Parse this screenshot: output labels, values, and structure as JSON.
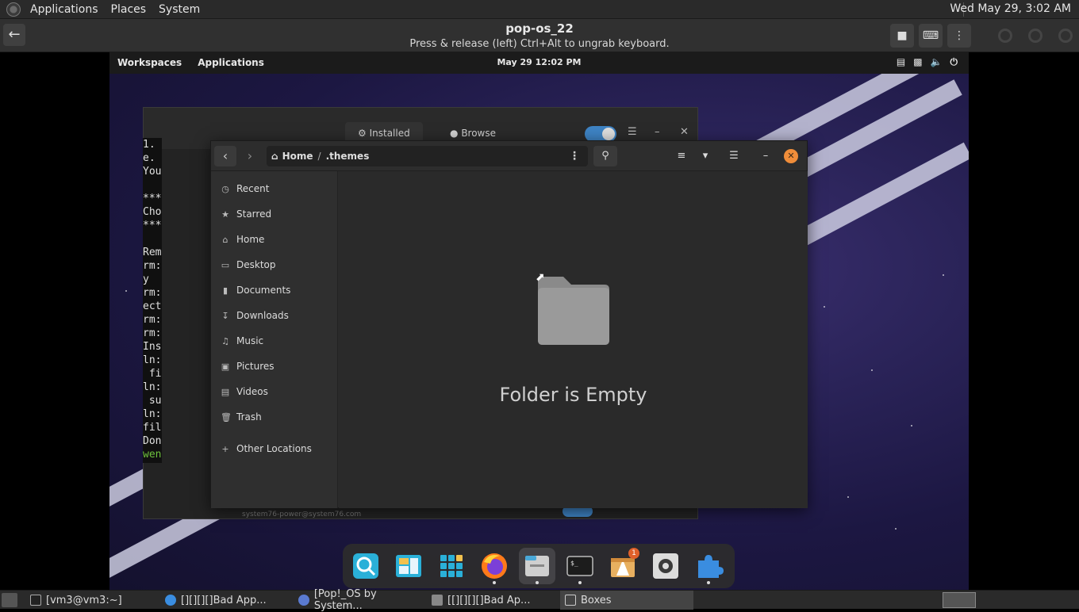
{
  "host_panel": {
    "menu": [
      "Applications",
      "Places",
      "System"
    ],
    "clock": "Wed May 29,  3:02 AM"
  },
  "boxes_header": {
    "title": "pop-os_22",
    "subtitle": "Press & release (left) Ctrl+Alt to ungrab keyboard."
  },
  "guest_bar": {
    "workspaces": "Workspaces",
    "applications": "Applications",
    "clock": "May 29  12:02 PM"
  },
  "shop_window": {
    "tab_installed": "Installed",
    "tab_browse": "Browse",
    "footer_email": "system76-power@system76.com"
  },
  "terminal_lines": [
    "1.",
    "e.",
    "You",
    "",
    "***",
    "Cho",
    "***",
    "",
    "Rem",
    "rm:",
    "y",
    "rm:",
    "ect",
    "rm:",
    "rm:",
    "Ins",
    "ln:",
    " fi",
    "ln:",
    " su",
    "ln:",
    "fil",
    "Don"
  ],
  "terminal_prompt": "wen",
  "file_manager": {
    "path": [
      "Home",
      ".themes"
    ],
    "sidebar": [
      {
        "label": "Recent",
        "icon": "clock-icon"
      },
      {
        "label": "Starred",
        "icon": "star-icon"
      },
      {
        "label": "Home",
        "icon": "home-icon"
      },
      {
        "label": "Desktop",
        "icon": "desktop-icon"
      },
      {
        "label": "Documents",
        "icon": "document-icon"
      },
      {
        "label": "Downloads",
        "icon": "download-icon"
      },
      {
        "label": "Music",
        "icon": "music-icon"
      },
      {
        "label": "Pictures",
        "icon": "picture-icon"
      },
      {
        "label": "Videos",
        "icon": "video-icon"
      },
      {
        "label": "Trash",
        "icon": "trash-icon"
      }
    ],
    "other_locations": "Other Locations",
    "empty_message": "Folder is Empty"
  },
  "dock": {
    "notification_count": "1"
  },
  "taskbar": {
    "tasks": [
      {
        "label": "[vm3@vm3:~]"
      },
      {
        "label": "[][][][]Bad App..."
      },
      {
        "label": "[Pop!_OS by System..."
      },
      {
        "label": "[[][][][]Bad Ap..."
      },
      {
        "label": "Boxes"
      }
    ]
  },
  "colors": {
    "accent_blue": "#3e83c4",
    "close_orange": "#f08d3a",
    "terminal_green": "#6ec23e"
  }
}
